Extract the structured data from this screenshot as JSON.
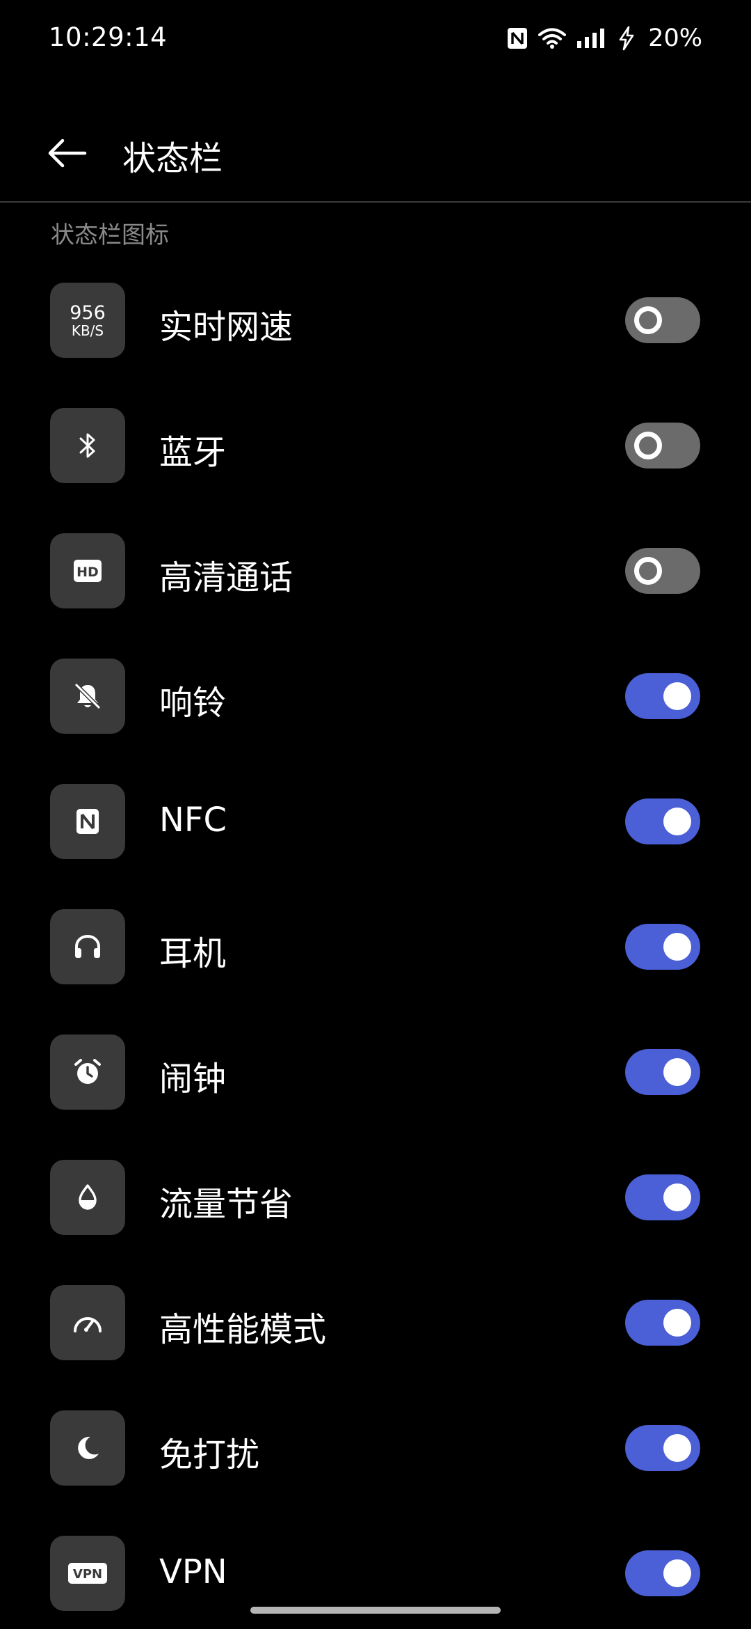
{
  "status_bar": {
    "time": "10:29:14",
    "battery": "20%",
    "icons": [
      "nfc-icon",
      "wifi-icon",
      "signal-icon",
      "charging-icon"
    ]
  },
  "header": {
    "title": "状态栏"
  },
  "section": {
    "label": "状态栏图标"
  },
  "netspeed_icon": {
    "value": "956",
    "unit": "KB/S"
  },
  "hd_icon": {
    "text": "HD"
  },
  "vpn_icon": {
    "text": "VPN"
  },
  "items": [
    {
      "label": "实时网速",
      "icon": "network-speed-icon",
      "enabled": false
    },
    {
      "label": "蓝牙",
      "icon": "bluetooth-icon",
      "enabled": false
    },
    {
      "label": "高清通话",
      "icon": "hd-call-icon",
      "enabled": false
    },
    {
      "label": "响铃",
      "icon": "ringer-muted-icon",
      "enabled": true
    },
    {
      "label": "NFC",
      "icon": "nfc-icon",
      "enabled": true
    },
    {
      "label": "耳机",
      "icon": "headphones-icon",
      "enabled": true
    },
    {
      "label": "闹钟",
      "icon": "alarm-icon",
      "enabled": true
    },
    {
      "label": "流量节省",
      "icon": "data-saver-icon",
      "enabled": true
    },
    {
      "label": "高性能模式",
      "icon": "performance-mode-icon",
      "enabled": true
    },
    {
      "label": "免打扰",
      "icon": "moon-icon",
      "enabled": true
    },
    {
      "label": "VPN",
      "icon": "vpn-icon",
      "enabled": true
    }
  ],
  "colors": {
    "background": "#000000",
    "toggle_on": "#4b5fd6",
    "toggle_off": "#6b6b6b",
    "icon_tile": "#3a3a3a"
  }
}
